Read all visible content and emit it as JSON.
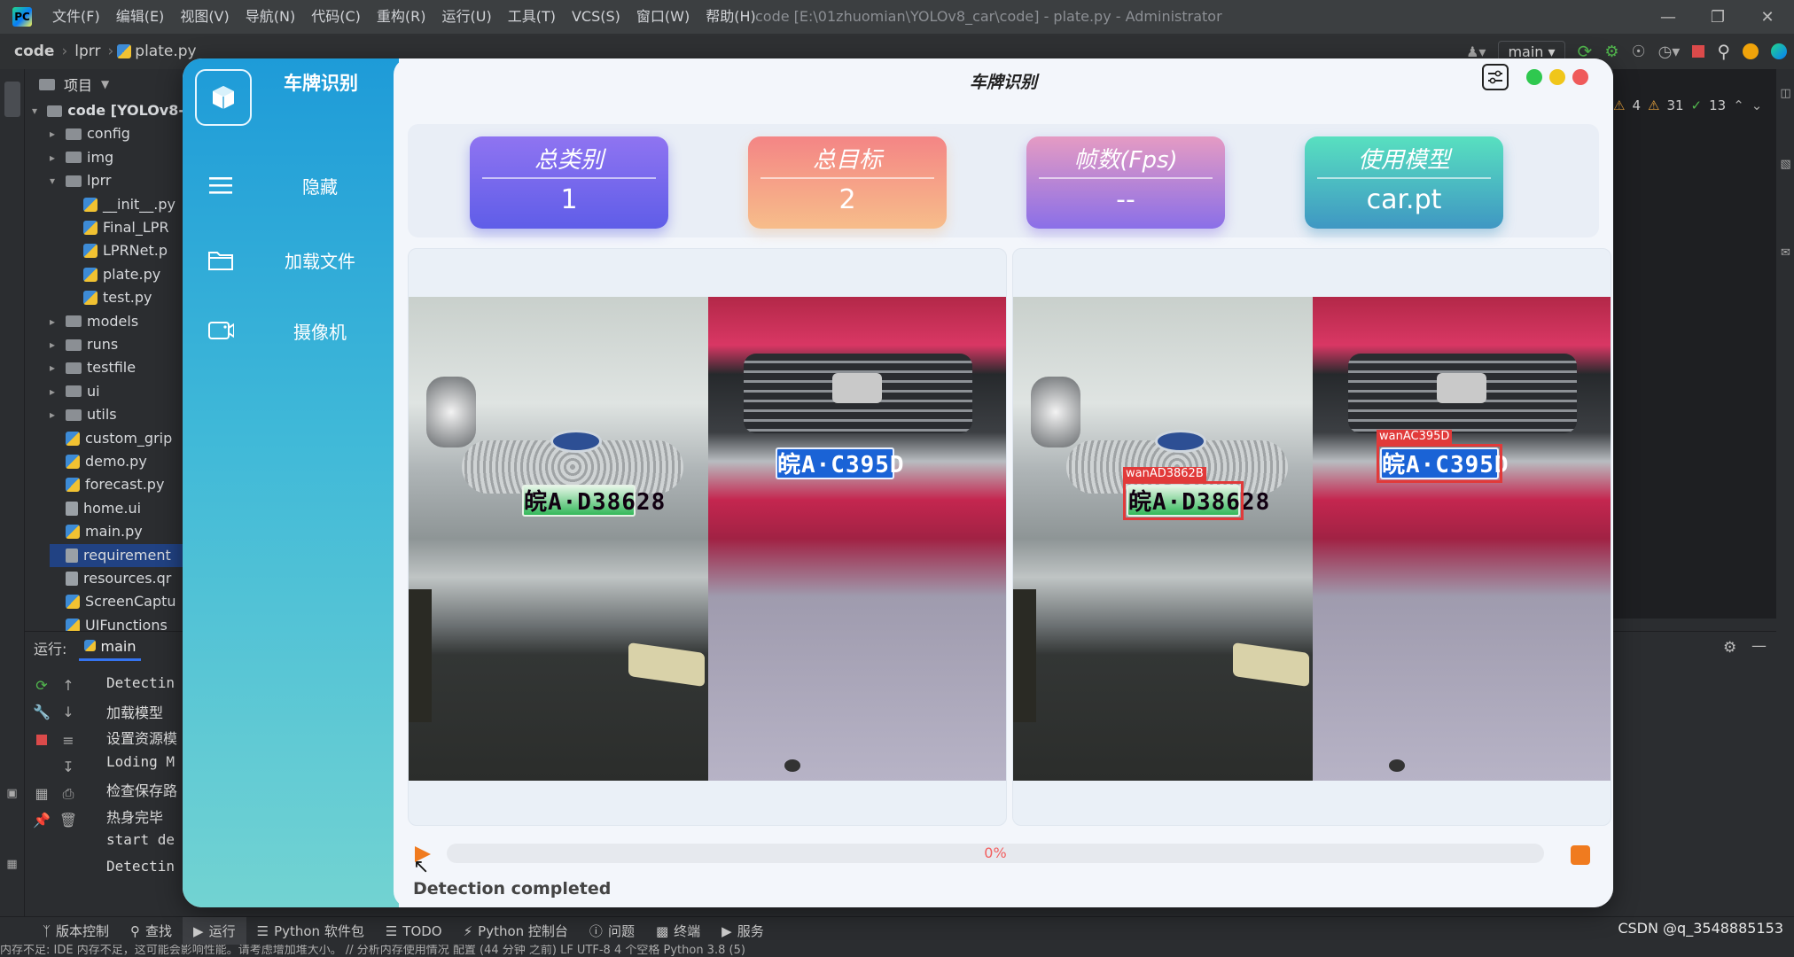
{
  "ide": {
    "menus": [
      "文件(F)",
      "编辑(E)",
      "视图(V)",
      "导航(N)",
      "代码(C)",
      "重构(R)",
      "运行(U)",
      "工具(T)",
      "VCS(S)",
      "窗口(W)",
      "帮助(H)"
    ],
    "window_title": "code [E:\\01zhuomian\\YOLOv8_car\\code] - plate.py - Administrator",
    "breadcrumb": [
      "code",
      "lprr",
      "plate.py"
    ],
    "branch": "main",
    "project_label": "项目",
    "tree": [
      {
        "label": "code [YOLOv8-",
        "type": "folder",
        "depth": 0,
        "open": true
      },
      {
        "label": "config",
        "type": "folder",
        "depth": 1,
        "open": false
      },
      {
        "label": "img",
        "type": "folder",
        "depth": 1,
        "open": false
      },
      {
        "label": "lprr",
        "type": "folder",
        "depth": 1,
        "open": true
      },
      {
        "label": "__init__.py",
        "type": "py",
        "depth": 2
      },
      {
        "label": "Final_LPR",
        "type": "py",
        "depth": 2
      },
      {
        "label": "LPRNet.p",
        "type": "py",
        "depth": 2
      },
      {
        "label": "plate.py",
        "type": "py",
        "depth": 2
      },
      {
        "label": "test.py",
        "type": "py",
        "depth": 2
      },
      {
        "label": "models",
        "type": "folder",
        "depth": 1,
        "open": false
      },
      {
        "label": "runs",
        "type": "folder",
        "depth": 1,
        "open": false
      },
      {
        "label": "testfile",
        "type": "folder",
        "depth": 1,
        "open": false
      },
      {
        "label": "ui",
        "type": "folder",
        "depth": 1,
        "open": false
      },
      {
        "label": "utils",
        "type": "folder",
        "depth": 1,
        "open": false
      },
      {
        "label": "custom_grip",
        "type": "py",
        "depth": 1
      },
      {
        "label": "demo.py",
        "type": "py",
        "depth": 1
      },
      {
        "label": "forecast.py",
        "type": "py",
        "depth": 1
      },
      {
        "label": "home.ui",
        "type": "other",
        "depth": 1
      },
      {
        "label": "main.py",
        "type": "py",
        "depth": 1
      },
      {
        "label": "requirement",
        "type": "other",
        "depth": 1,
        "selected": true
      },
      {
        "label": "resources.qr",
        "type": "other",
        "depth": 1
      },
      {
        "label": "ScreenCaptu",
        "type": "py",
        "depth": 1
      },
      {
        "label": "UIFunctions",
        "type": "py",
        "depth": 1
      }
    ],
    "run_label": "运行:",
    "run_tab": "main",
    "run_lines": [
      "Detectin",
      "加载模型",
      "设置资源模",
      "Loding M",
      "检查保存路",
      "热身完毕",
      "start de",
      "Detectin"
    ],
    "inspections": {
      "warnings": "4",
      "weak": "31",
      "ok": "13"
    },
    "bottom_tools": [
      "版本控制",
      "查找",
      "运行",
      "Python 软件包",
      "TODO",
      "Python 控制台",
      "问题",
      "终端",
      "服务"
    ],
    "watermark": "CSDN @q_3548885153",
    "statusbar": "内存不足: IDE 内存不足，这可能会影响性能。请考虑增加堆大小。 // 分析内存使用情况  配置 (44 分钟 之前)                                                                                                                                                                     LF  UTF-8  4 个空格  Python 3.8 (5)"
  },
  "app": {
    "sidebar_title": "车牌识别",
    "menu_items": [
      {
        "label": "隐藏",
        "icon": "hamburger-menu-icon"
      },
      {
        "label": "加载文件",
        "icon": "folder-icon"
      },
      {
        "label": "摄像机",
        "icon": "camera-icon"
      }
    ],
    "window_title": "车牌识别",
    "cards": [
      {
        "title": "总类别",
        "value": "1",
        "gradient": [
          "#8f74f1",
          "#5f5de8"
        ]
      },
      {
        "title": "总目标",
        "value": "2",
        "gradient": [
          "#f48585",
          "#f7bd8a"
        ]
      },
      {
        "title": "帧数(Fps)",
        "value": "--",
        "gradient": [
          "#e59bc3",
          "#8a6fe8"
        ]
      },
      {
        "title": "使用模型",
        "value": "car.pt",
        "gradient": [
          "#58e0c0",
          "#3f97c3"
        ]
      }
    ],
    "plates": {
      "green": "皖A·D38628",
      "blue": "皖A·C395D"
    },
    "detections": [
      "wanAD3862B",
      "wanAC395D"
    ],
    "progress": {
      "percent": 0,
      "text": "0%"
    },
    "status": "Detection completed",
    "dots": [
      "#2fc84f",
      "#f0c61a",
      "#ef5a5a"
    ]
  }
}
